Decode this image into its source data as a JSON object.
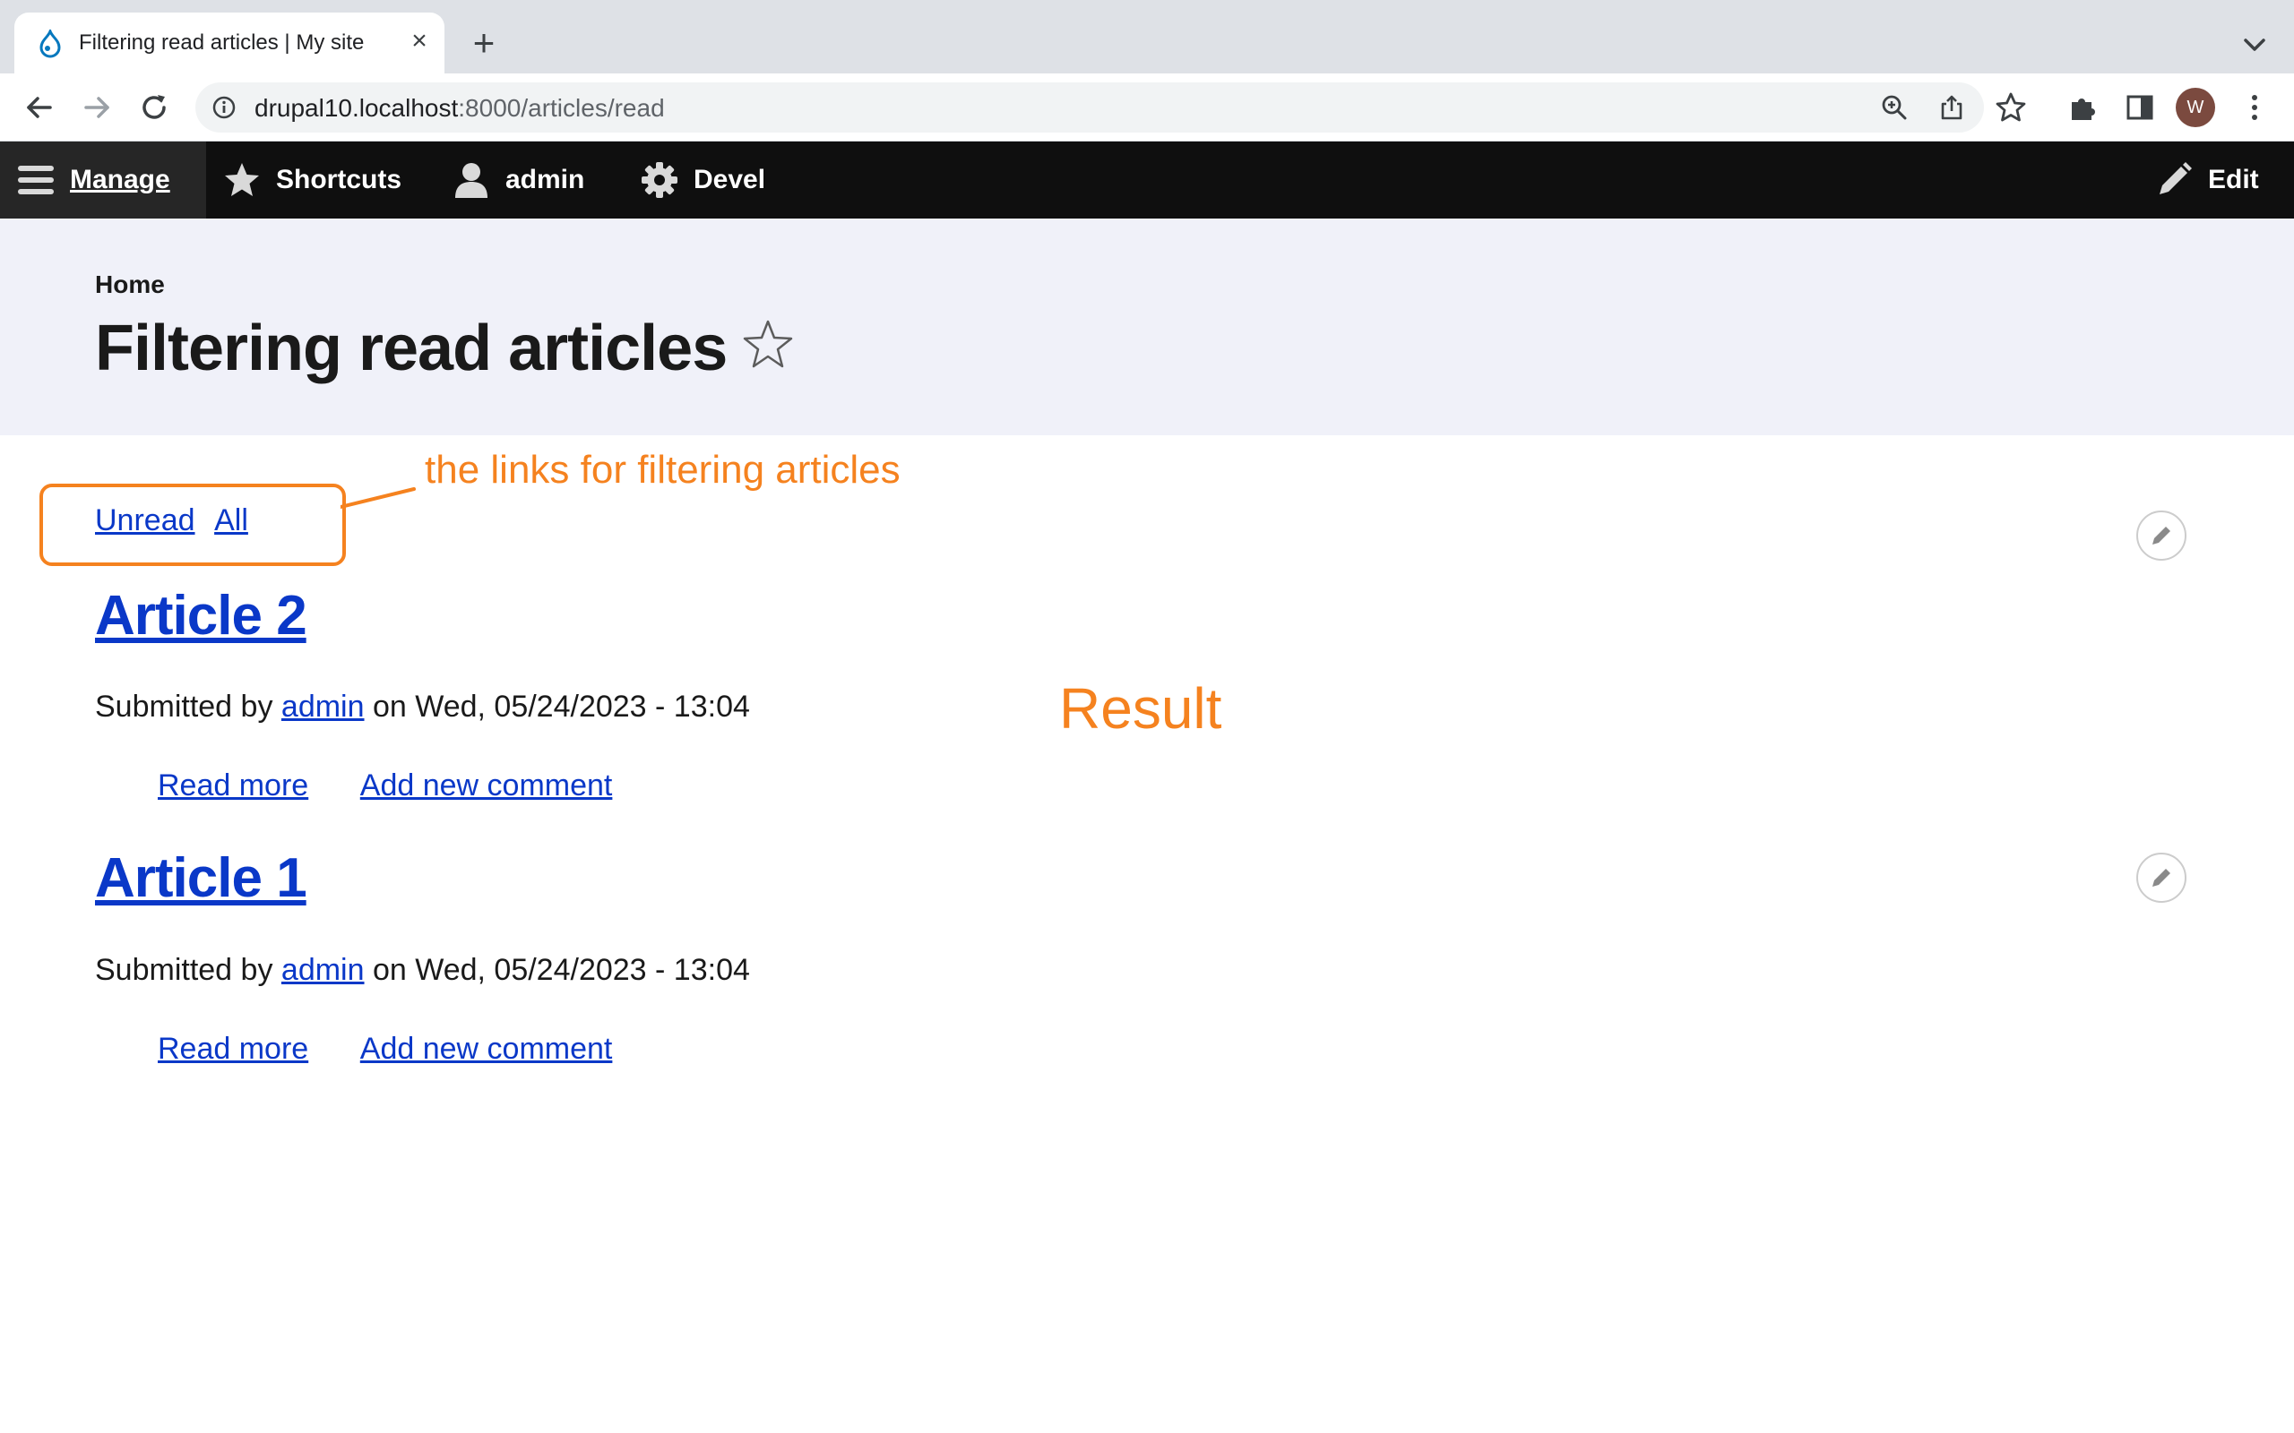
{
  "browser": {
    "tab_title": "Filtering read articles | My site",
    "url_host": "drupal10.localhost",
    "url_path": ":8000/articles/read",
    "avatar_letter": "W"
  },
  "admin_toolbar": {
    "manage": "Manage",
    "shortcuts": "Shortcuts",
    "user": "admin",
    "devel": "Devel",
    "edit": "Edit"
  },
  "page": {
    "breadcrumb": "Home",
    "title": "Filtering read articles"
  },
  "filter_links": {
    "unread": "Unread",
    "all": "All"
  },
  "annotations": {
    "callout": "the links for filtering articles",
    "result": "Result",
    "color": "#f5821f"
  },
  "articles": [
    {
      "title": "Article 2",
      "submitted_prefix": "Submitted by",
      "author": "admin",
      "date_text": "on Wed, 05/24/2023 - 13:04",
      "read_more": "Read more",
      "add_comment": "Add new comment"
    },
    {
      "title": "Article 1",
      "submitted_prefix": "Submitted by",
      "author": "admin",
      "date_text": "on Wed, 05/24/2023 - 13:04",
      "read_more": "Read more",
      "add_comment": "Add new comment"
    }
  ],
  "colors": {
    "link": "#0a38c8",
    "admin_bar": "#0f0f0f",
    "header_band": "#f0f1f9"
  }
}
